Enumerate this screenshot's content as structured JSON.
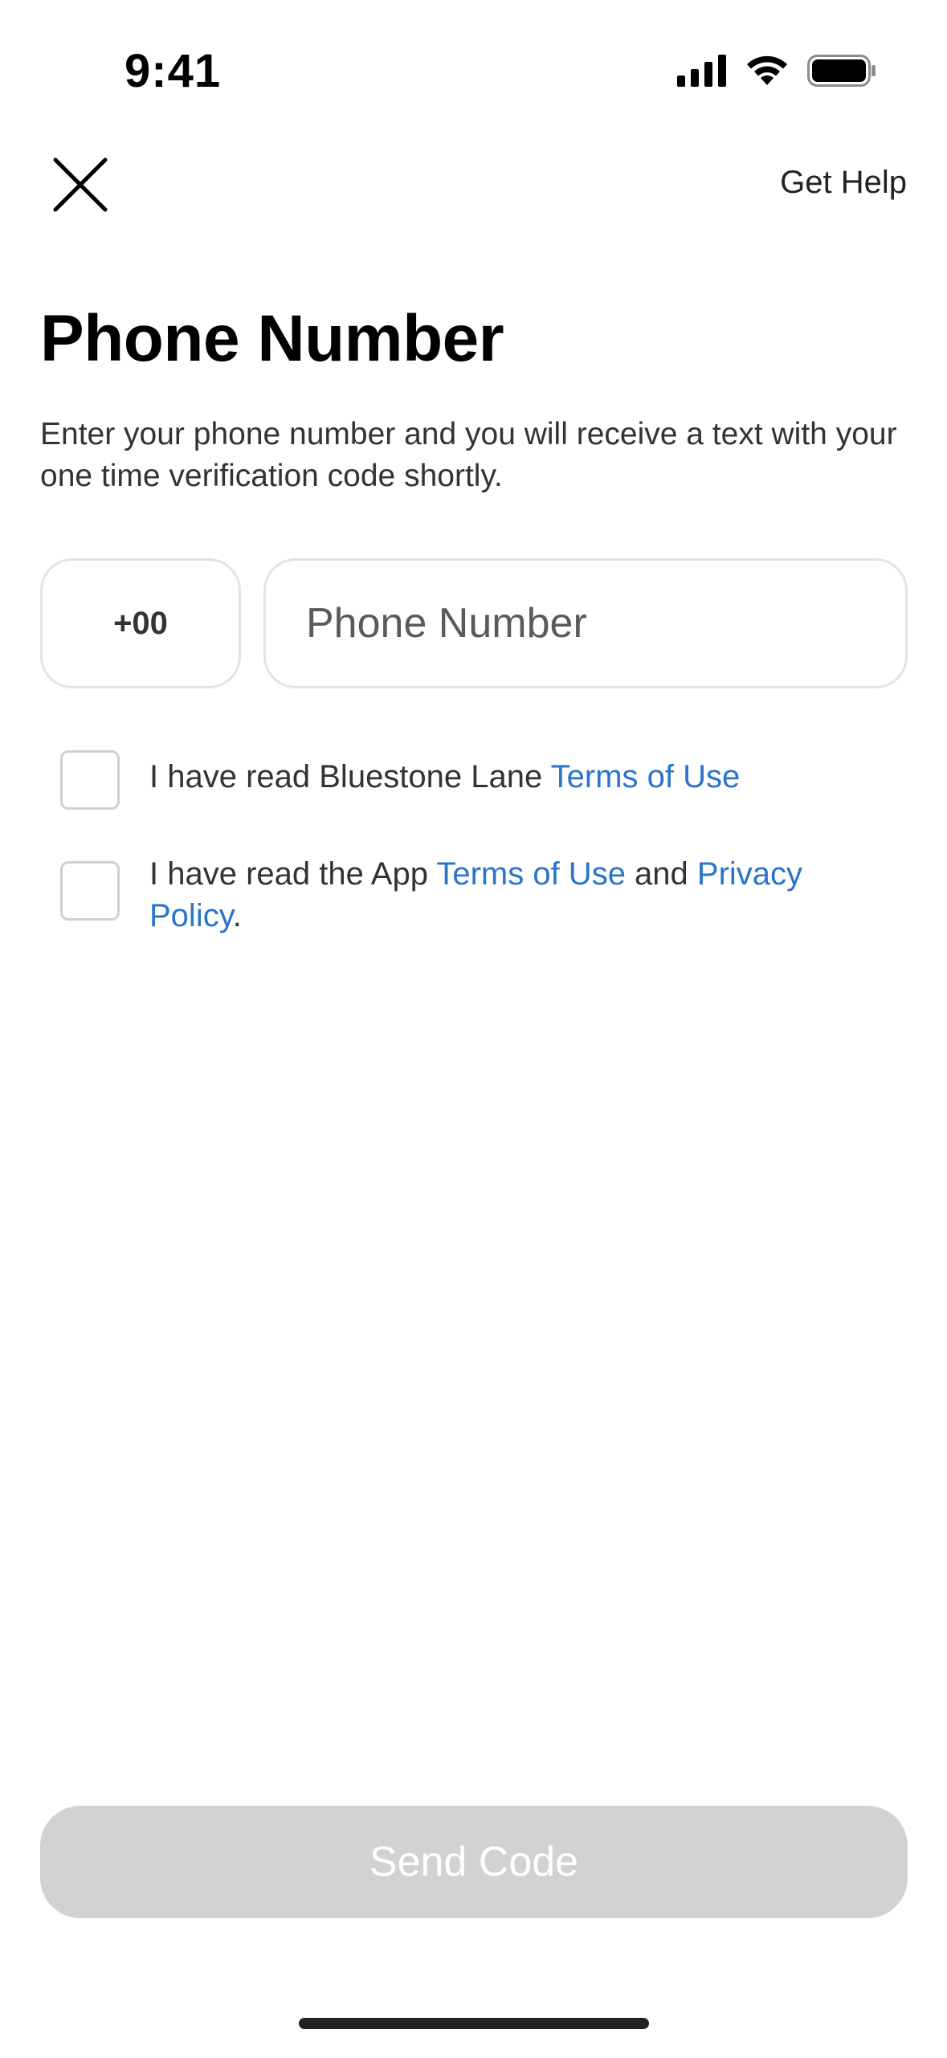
{
  "status_bar": {
    "time": "9:41"
  },
  "nav": {
    "get_help_label": "Get Help"
  },
  "page": {
    "title": "Phone Number",
    "description": "Enter your phone number and you will receive a text with your one time verification code shortly."
  },
  "form": {
    "country_code": "+00",
    "phone_placeholder": "Phone Number",
    "phone_value": ""
  },
  "agreements": {
    "first": {
      "prefix": "I have read Bluestone Lane ",
      "link": "Terms of Use"
    },
    "second": {
      "prefix": "I have read the App ",
      "link1": "Terms of Use",
      "middle": " and ",
      "link2": "Privacy Policy",
      "suffix": "."
    }
  },
  "actions": {
    "send_code_label": "Send Code"
  },
  "colors": {
    "link": "#2a74c9",
    "button_disabled": "#d2d2d2",
    "border": "#e3e3e3"
  }
}
